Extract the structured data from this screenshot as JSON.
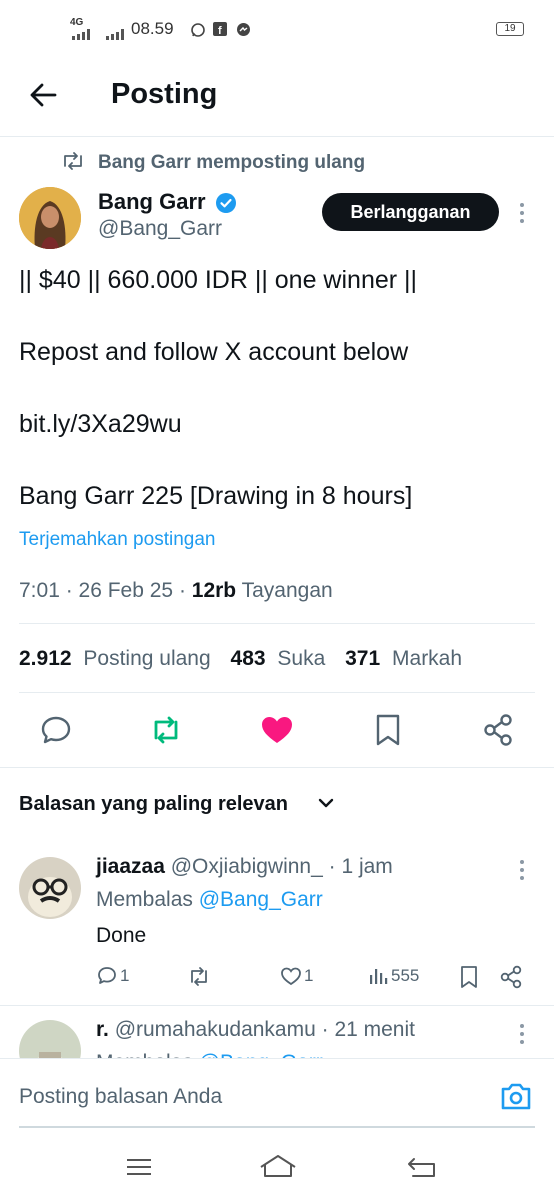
{
  "status_bar": {
    "network": "4G",
    "time": "08.59",
    "battery": "19"
  },
  "header": {
    "title": "Posting"
  },
  "post": {
    "repost_label": "Bang Garr memposting ulang",
    "author_name": "Bang Garr",
    "author_handle": "@Bang_Garr",
    "subscribe_label": "Berlangganan",
    "lines": [
      "|| $40 || 660.000 IDR || one winner ||",
      "Repost and follow X account below",
      "bit.ly/3Xa29wu",
      "Bang Garr 225 [Drawing in 8 hours]"
    ],
    "translate_label": "Terjemahkan postingan",
    "time": "7:01 · 26 Feb 25 · ",
    "views_count": "12rb",
    "views_label": " Tayangan",
    "reposts_count": "2.912",
    "reposts_label": "Posting ulang",
    "likes_count": "483",
    "likes_label": "Suka",
    "bookmarks_count": "371",
    "bookmarks_label": "Markah"
  },
  "colors": {
    "accent": "#1d9bf0",
    "repost": "#00ba7c",
    "like": "#f91880",
    "text": "#0f1419",
    "muted": "#536471"
  },
  "replies_sort": {
    "label": "Balasan yang paling relevan"
  },
  "replies": [
    {
      "name": "jiaazaa",
      "handle_time": " @Oxjiabigwinn_ · 1 jam",
      "replying_prefix": "Membalas ",
      "replying_to": "@Bang_Garr",
      "text": "Done",
      "reply_count": "1",
      "like_count": "1",
      "view_count": "555"
    },
    {
      "name": "r.",
      "handle_time": " @rumahakudankamu · 21 menit",
      "replying_prefix": "Membalas ",
      "replying_to": "@Bang_Garr"
    }
  ],
  "compose": {
    "placeholder": "Posting balasan Anda"
  }
}
